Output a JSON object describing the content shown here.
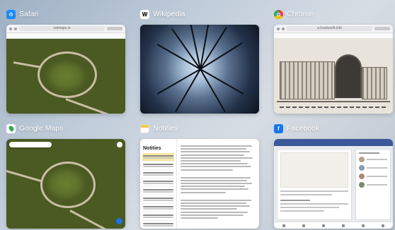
{
  "switcher": {
    "cards": [
      {
        "app": "Safari",
        "icon": "safari-icon",
        "color": "#1a8cff",
        "glyph": "⊙",
        "url": "satmaps.io"
      },
      {
        "app": "Wikipedia",
        "icon": "wikipedia-icon",
        "color": "#ffffff",
        "glyph": "W"
      },
      {
        "app": "Chrome",
        "icon": "chrome-icon",
        "color": "#e94235",
        "glyph": "●",
        "url": "a.howtoedit.info"
      },
      {
        "app": "Google Maps",
        "icon": "google-maps-icon",
        "color": "#34a853",
        "glyph": "●"
      },
      {
        "app": "Notities",
        "icon": "notes-icon",
        "color": "#f7c948",
        "glyph": "▬",
        "notes_heading": "Notities"
      },
      {
        "app": "Facebook",
        "icon": "facebook-icon",
        "color": "#1877f2",
        "glyph": "f"
      }
    ]
  }
}
